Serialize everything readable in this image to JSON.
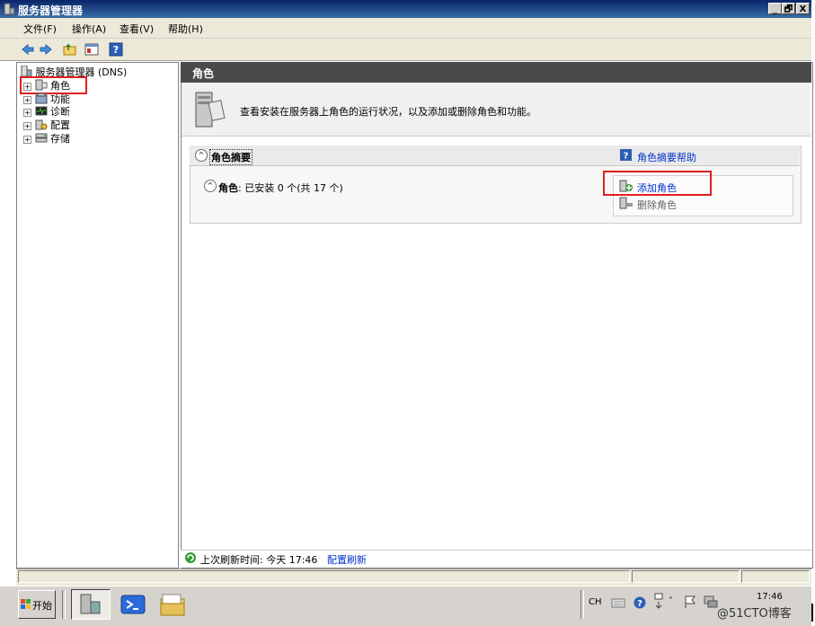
{
  "window": {
    "title": "服务器管理器",
    "btn_min": "_",
    "btn_max": "🗗",
    "btn_close": "X"
  },
  "menu": {
    "items": [
      "文件(F)",
      "操作(A)",
      "查看(V)",
      "帮助(H)"
    ]
  },
  "tree": {
    "root": "服务器管理器 (DNS)",
    "items": [
      "角色",
      "功能",
      "诊断",
      "配置",
      "存储"
    ]
  },
  "main": {
    "header": "角色",
    "description": "查看安装在服务器上角色的运行状况，以及添加或删除角色和功能。",
    "summary_title": "角色摘要",
    "summary_help": "角色摘要帮助",
    "roles_label": "角色",
    "roles_status": ": 已安装 0 个(共 17 个)",
    "add_roles": "添加角色",
    "remove_roles": "删除角色",
    "refresh_text": "上次刷新时间: 今天 17:46",
    "refresh_link": "配置刷新"
  },
  "taskbar": {
    "start": "开始",
    "lang": "CH",
    "clock": "17:46",
    "watermark": "@51CTO博客"
  },
  "colors": {
    "accent_red": "#e02020",
    "link": "#0033cc",
    "header_bg": "#4a4a4a"
  }
}
